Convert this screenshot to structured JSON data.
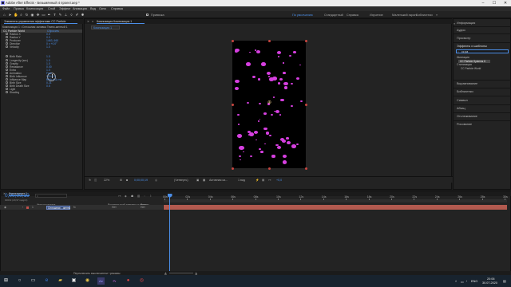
{
  "window": {
    "title": "Adobe After Effects - Безымянный 4 проект.aep *",
    "controls": [
      "–",
      "☐",
      "✕"
    ]
  },
  "menu": [
    "Файл",
    "Правка",
    "Композиция",
    "Слой",
    "Эффект",
    "Анимация",
    "Вид",
    "Окно",
    "Справка"
  ],
  "toolbar": {
    "snap_label": "Привязка",
    "workspaces": [
      "По умолчанию",
      "Стандартный",
      "Справка",
      "Изучение",
      "Маленький экран",
      "Библиотеки"
    ],
    "active_workspace": "По умолчанию",
    "search_placeholder": "Поиск в справке"
  },
  "effects_panel": {
    "tab": "Элементы управления эффектами CC Particle",
    "header": "Композиция 1 • Сплошная заливка Темно-желтый 1",
    "effect_name": "CC Particle World",
    "reset": "Сбросить",
    "props": [
      {
        "name": "Radius X",
        "value": "0.0"
      },
      {
        "name": "Radius Y",
        "value": "0.0"
      },
      {
        "name": "Producer",
        "value": "1463, 660"
      },
      {
        "name": "Direction",
        "value": "0 x +0,0°"
      },
      {
        "name": "Velocity",
        "value": "1.0"
      },
      {
        "name": "Birth Rate",
        "value": "1.0"
      },
      {
        "name": "Longevity (sec)",
        "value": "1.0"
      },
      {
        "name": "Gravity",
        "value": "1.0"
      },
      {
        "name": "Resistance",
        "value": "0.00"
      },
      {
        "name": "Extra",
        "value": "1.0"
      },
      {
        "name": "Animation",
        "value": "Free"
      },
      {
        "name": "Birth Influence",
        "value": "100.0 %"
      },
      {
        "name": "Influence Map",
        "value": "Birth is & rnd"
      },
      {
        "name": "Birth Size",
        "value": "0.21"
      },
      {
        "name": "Birth Death Size",
        "value": "0.5"
      },
      {
        "name": "Light",
        "value": ""
      },
      {
        "name": "Shading",
        "value": ""
      }
    ]
  },
  "composition": {
    "tab": "Композиция Композиция 1",
    "sub_tab": "Композиция 1",
    "viewer": {
      "zoom": "22%",
      "timecode": "0;00;00;19",
      "quality": "(Четверть)",
      "camera": "Активная ка...",
      "views": "1 вид",
      "exposure": "+0,0"
    }
  },
  "right_panel": {
    "sections": [
      "Информация",
      "Аудио",
      "Просмотр",
      "Эффекты и шаблоны",
      "Выравнивание",
      "Библиотеки",
      "Символ",
      "Абзац",
      "Отслеживание",
      "Рисование"
    ],
    "effects_search": "cc pa",
    "category1": "Имитация",
    "item1": "CC Particle Systems II",
    "category2": "Стилизация",
    "item2": "CC Particle World"
  },
  "timeline": {
    "tab": "Композиция 1",
    "timecode": "0;00;00;19",
    "frames": "00019 (29,97 кадр/с)",
    "columns": [
      "Имя источника",
      "Родительский элемент и связь",
      "Режим"
    ],
    "layer": {
      "index": "1",
      "name": "Сплошная ...желтый 1",
      "mode": "Нет",
      "switch": "Нет"
    },
    "ruler": [
      "00s",
      "02s",
      "04s",
      "06s",
      "08s",
      "10s",
      "12s",
      "14s",
      "16s",
      "18s",
      "20s",
      "22s",
      "24s",
      "26s",
      "28s",
      "30s"
    ],
    "bottom": "Переключить выключатели / режимы"
  },
  "taskbar": {
    "clock_time": "20:06",
    "clock_date": "30.07.2020",
    "lang": "ENG"
  },
  "colors": {
    "accent": "#4b8ee8",
    "particle": "#d63fe0",
    "track": "#b35a4f"
  }
}
